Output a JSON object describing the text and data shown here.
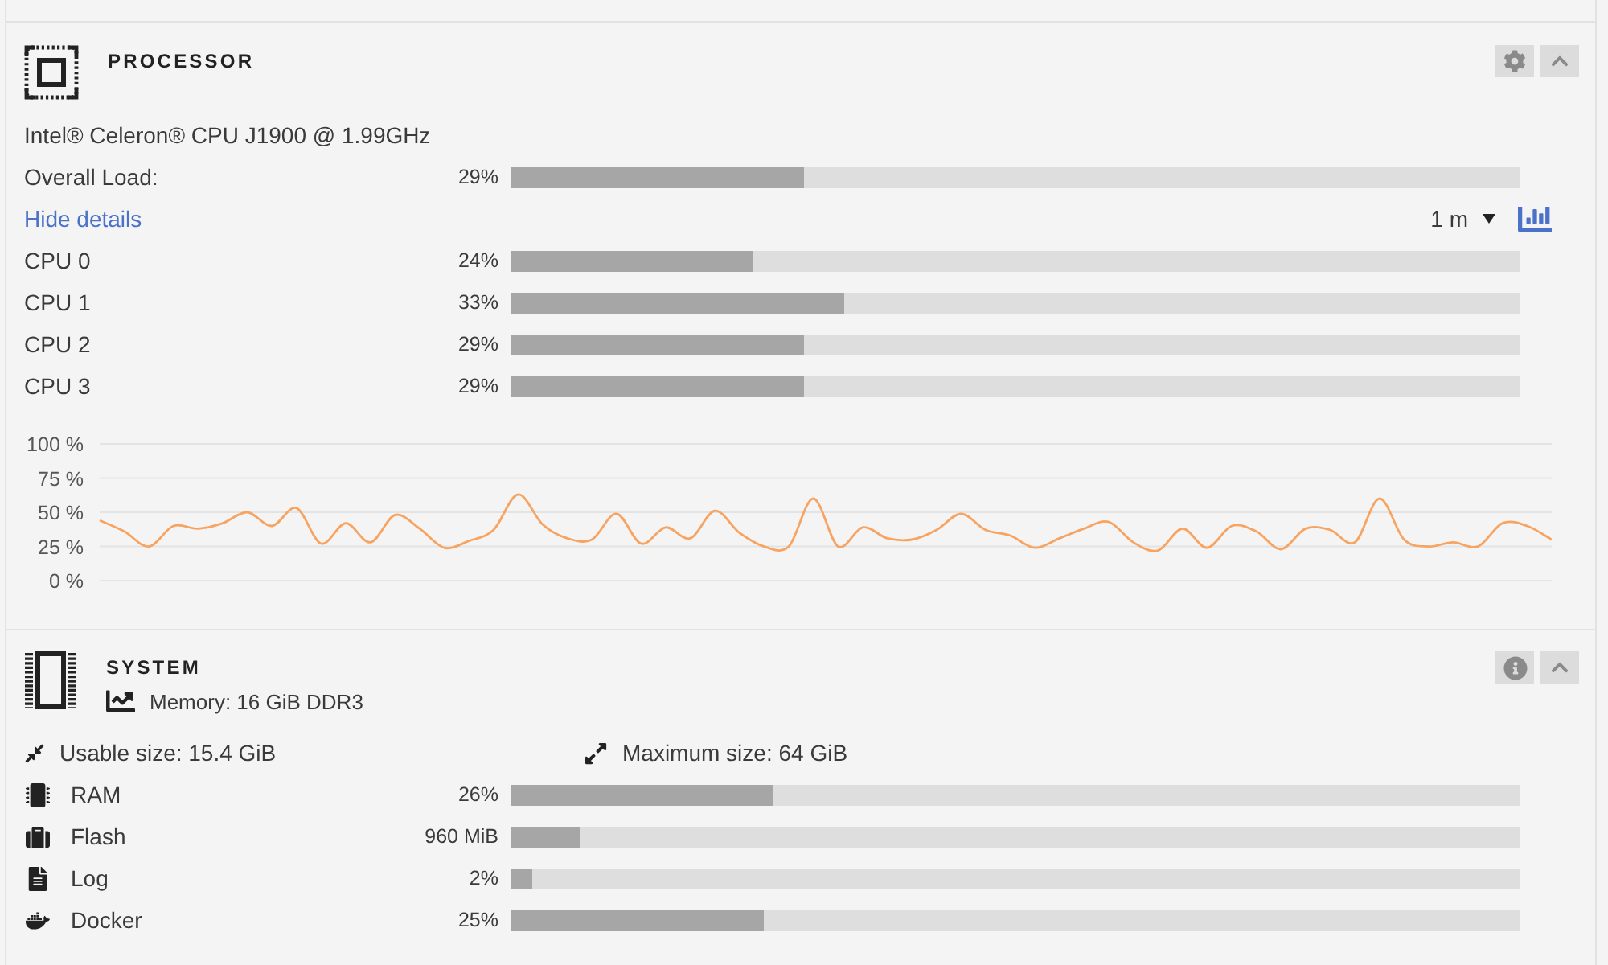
{
  "processor": {
    "title": "PROCESSOR",
    "model": "Intel® Celeron® CPU J1900 @ 1.99GHz",
    "overall": {
      "label": "Overall Load:",
      "reading": "29%",
      "level": 0.29
    },
    "details_link": "Hide details",
    "interval": "1 m",
    "cores": [
      {
        "name": "CPU 0",
        "reading": "24%",
        "level": 0.24
      },
      {
        "name": "CPU 1",
        "reading": "33%",
        "level": 0.33
      },
      {
        "name": "CPU 2",
        "reading": "29%",
        "level": 0.29
      },
      {
        "name": "CPU 3",
        "reading": "29%",
        "level": 0.29
      }
    ],
    "chart_data": {
      "type": "line",
      "ylim": [
        0,
        100
      ],
      "yticks": [
        {
          "value": 0,
          "label": "0 %"
        },
        {
          "value": 25,
          "label": "25 %"
        },
        {
          "value": 50,
          "label": "50 %"
        },
        {
          "value": 75,
          "label": "75 %"
        },
        {
          "value": 100,
          "label": "100 %"
        }
      ],
      "tick_labels": "y",
      "grid": true,
      "color": "#f7a462",
      "values": [
        44,
        36,
        25,
        40,
        38,
        42,
        50,
        40,
        53,
        27,
        42,
        28,
        48,
        38,
        24,
        29,
        37,
        63,
        41,
        31,
        30,
        49,
        27,
        39,
        31,
        51,
        35,
        25,
        25,
        60,
        25,
        39,
        31,
        30,
        37,
        49,
        37,
        33,
        24,
        31,
        38,
        43,
        28,
        22,
        38,
        24,
        40,
        36,
        23,
        38,
        37,
        28,
        60,
        30,
        25,
        28,
        25,
        42,
        40,
        30
      ]
    }
  },
  "system": {
    "title": "SYSTEM",
    "memory": "Memory: 16 GiB DDR3",
    "usable": "Usable size: 15.4 GiB",
    "maximum": "Maximum size: 64 GiB",
    "items": [
      {
        "kind": "ram",
        "name": "RAM",
        "reading": "26%",
        "level": 0.26
      },
      {
        "kind": "flash",
        "name": "Flash",
        "reading": "960 MiB",
        "level": 0.069
      },
      {
        "kind": "log",
        "name": "Log",
        "reading": "2%",
        "level": 0.02
      },
      {
        "kind": "docker",
        "name": "Docker",
        "reading": "25%",
        "level": 0.25
      }
    ]
  }
}
